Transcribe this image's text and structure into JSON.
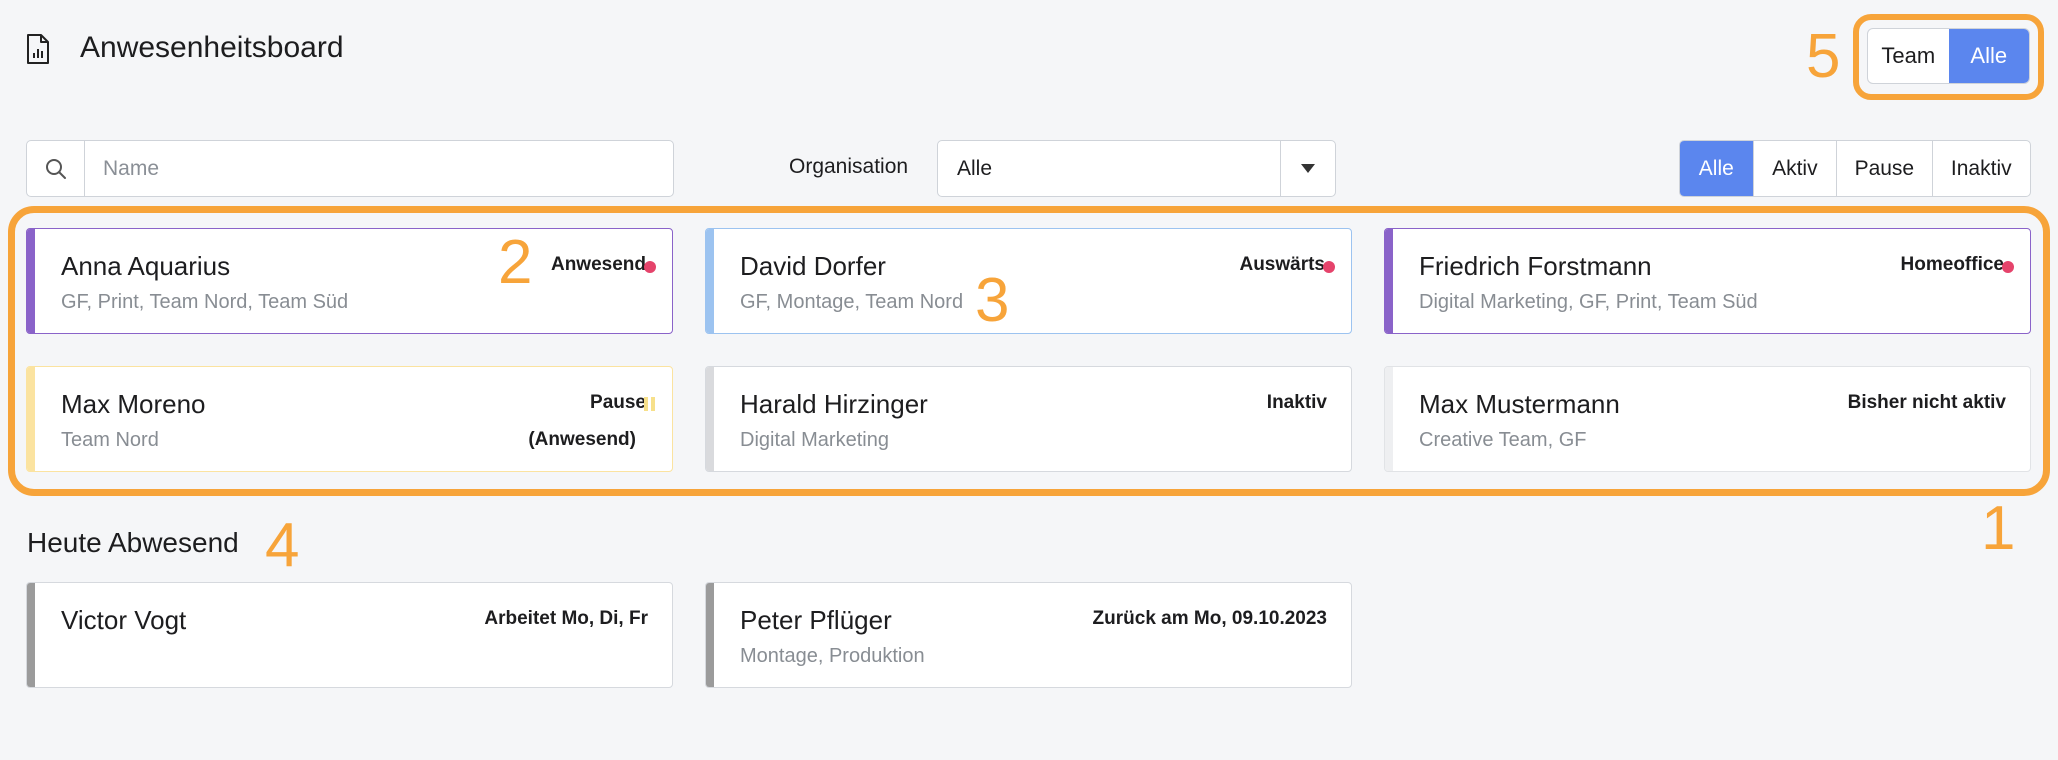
{
  "header": {
    "title": "Anwesenheitsboard",
    "icon": "document-chart-icon"
  },
  "view_toggle": {
    "options": [
      "Team",
      "Alle"
    ],
    "selected": "Alle"
  },
  "search": {
    "placeholder": "Name",
    "value": ""
  },
  "organisation": {
    "label": "Organisation",
    "selected": "Alle"
  },
  "status_filter": {
    "options": [
      "Alle",
      "Aktiv",
      "Pause",
      "Inaktiv"
    ],
    "selected": "Alle"
  },
  "annotations": [
    "1",
    "2",
    "3",
    "4",
    "5"
  ],
  "colors": {
    "accent": "#5b86ee",
    "highlight": "#f7a43a",
    "status_dot": "#e5436b",
    "bar_purple": "#8a63c9",
    "bar_blue": "#9cc3f0",
    "bar_yellow": "#fbe3a0",
    "bar_grey": "#d9dadd",
    "bar_dark_grey": "#9b9b9b"
  },
  "present": [
    {
      "name": "Anna Aquarius",
      "groups": "GF, Print, Team Nord, Team Süd",
      "status": "Anwesend",
      "indicator": "dot",
      "bar": "#8a63c9",
      "border": "#8a63c9"
    },
    {
      "name": "David Dorfer",
      "groups": "GF, Montage, Team Nord",
      "status": "Auswärts",
      "indicator": "dot",
      "bar": "#9cc3f0",
      "border": "#9cc3f0"
    },
    {
      "name": "Friedrich Forstmann",
      "groups": "Digital Marketing, GF, Print, Team Süd",
      "status": "Homeoffice",
      "indicator": "dot",
      "bar": "#8a63c9",
      "border": "#8a63c9"
    },
    {
      "name": "Max Moreno",
      "groups": "Team Nord",
      "status": "Pause",
      "substatus": "(Anwesend)",
      "indicator": "pause",
      "bar": "#fbe3a0",
      "border": "#fbe3a0"
    },
    {
      "name": "Harald Hirzinger",
      "groups": "Digital Marketing",
      "status": "Inaktiv",
      "indicator": "none",
      "bar": "#d9dadd",
      "border": "#d6d9de"
    },
    {
      "name": "Max Mustermann",
      "groups": "Creative Team, GF",
      "status": "Bisher nicht aktiv",
      "indicator": "none",
      "bar": "#eeeff1",
      "border": "#e1e3e6"
    }
  ],
  "absent_section": {
    "title": "Heute Abwesend"
  },
  "absent": [
    {
      "name": "Victor Vogt",
      "groups": "",
      "status": "Arbeitet Mo, Di, Fr",
      "bar": "#9b9b9b"
    },
    {
      "name": "Peter Pflüger",
      "groups": "Montage, Produktion",
      "status": "Zurück am Mo, 09.10.2023",
      "bar": "#9b9b9b"
    }
  ]
}
